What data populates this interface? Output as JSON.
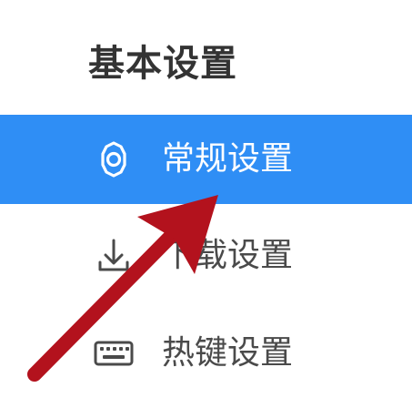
{
  "section": {
    "title": "基本设置"
  },
  "nav": {
    "items": [
      {
        "label": "常规设置",
        "icon": "gear-icon",
        "active": true
      },
      {
        "label": "下载设置",
        "icon": "download-icon",
        "active": false
      },
      {
        "label": "热键设置",
        "icon": "keyboard-icon",
        "active": false
      }
    ]
  },
  "colors": {
    "active_bg": "#2f8ef5",
    "active_text": "#ffffff",
    "text": "#4a4a4a",
    "title": "#333333",
    "annotation_arrow": "#b3121d"
  }
}
